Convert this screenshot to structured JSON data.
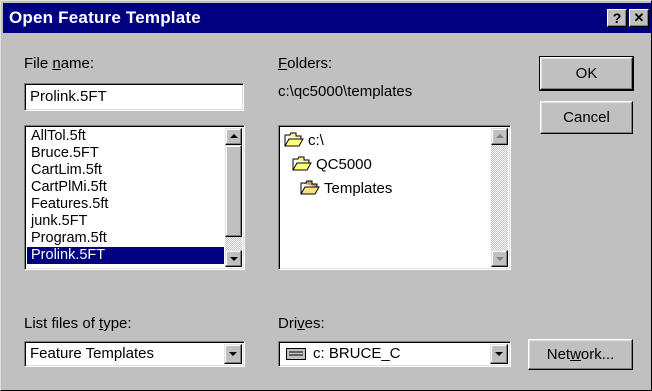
{
  "dialog": {
    "title": "Open Feature Template",
    "help_button": "?",
    "close_button": "✕"
  },
  "file_name": {
    "label_prefix": "File ",
    "label_mnemonic": "n",
    "label_suffix": "ame:",
    "value": "Prolink.5FT"
  },
  "file_list": {
    "items": [
      "AllTol.5ft",
      "Bruce.5FT",
      "CartLim.5ft",
      "CartPlMi.5ft",
      "Features.5ft",
      "junk.5FT",
      "Program.5ft",
      "Prolink.5FT"
    ],
    "selected": "Prolink.5FT"
  },
  "folders": {
    "label_mnemonic": "F",
    "label_suffix": "olders:",
    "current_path": "c:\\qc5000\\templates",
    "tree": [
      {
        "label": "c:\\",
        "icon": "open-folder-icon"
      },
      {
        "label": "QC5000",
        "icon": "open-folder-icon"
      },
      {
        "label": "Templates",
        "icon": "open-folder-icon"
      }
    ]
  },
  "buttons": {
    "ok": "OK",
    "cancel": "Cancel",
    "network_prefix": "Net",
    "network_mnemonic": "w",
    "network_suffix": "ork..."
  },
  "file_type": {
    "label_prefix": "List files of ",
    "label_mnemonic": "t",
    "label_suffix": "ype:",
    "value": "Feature Templates"
  },
  "drives": {
    "label_prefix": "Dri",
    "label_mnemonic": "v",
    "label_suffix": "es:",
    "value": "c: BRUCE_C",
    "icon": "drive-icon"
  },
  "colors": {
    "title_bar": "#000080",
    "face": "#c0c0c0",
    "selection": "#000080"
  }
}
